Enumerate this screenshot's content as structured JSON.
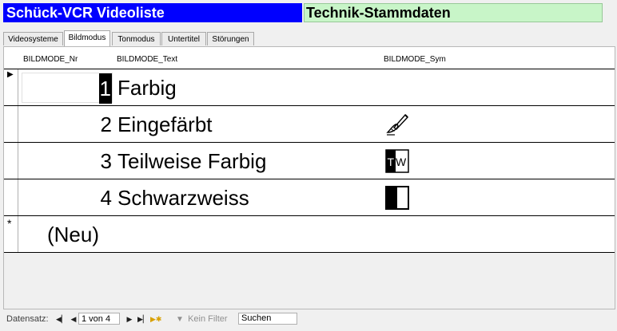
{
  "header": {
    "left_title": "Schück-VCR Videoliste",
    "right_title": "Technik-Stammdaten",
    "left_bg": "#0000FF",
    "right_bg": "#C8F5C8"
  },
  "tabs": [
    {
      "label": "Videosysteme",
      "active": false
    },
    {
      "label": "Bildmodus",
      "active": true
    },
    {
      "label": "Tonmodus",
      "active": false
    },
    {
      "label": "Untertitel",
      "active": false
    },
    {
      "label": "Störungen",
      "active": false
    }
  ],
  "columns": {
    "nr": "BILDMODE_Nr",
    "text": "BILDMODE_Text",
    "sym": "BILDMODE_Sym"
  },
  "rows": [
    {
      "nr": "1",
      "text": "Farbig",
      "sym_icon": "none",
      "current": true
    },
    {
      "nr": "2",
      "text": "Eingefärbt",
      "sym_icon": "pen-hand-icon"
    },
    {
      "nr": "3",
      "text": "Teilweise Farbig",
      "sym_icon": "tw-badge-icon",
      "sym_text": "TW"
    },
    {
      "nr": "4",
      "text": "Schwarzweiss",
      "sym_icon": "half-black-white-icon"
    }
  ],
  "new_row": {
    "marker": "*",
    "text": "(Neu)"
  },
  "navigation": {
    "label": "Datensatz:",
    "record_value": "1 von 4",
    "filter_label": "Kein Filter",
    "search_placeholder": "Suchen"
  }
}
